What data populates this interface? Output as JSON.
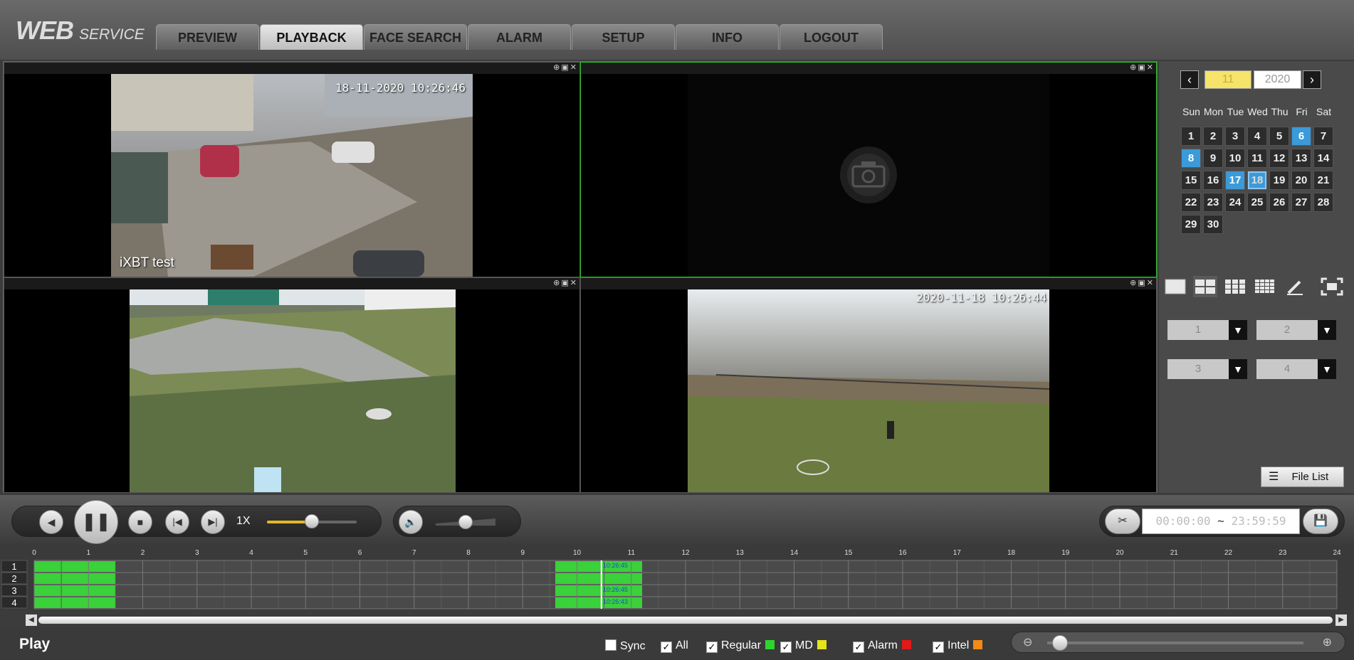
{
  "header": {
    "logo_main": "WEB",
    "logo_sub": "SERVICE",
    "tabs": [
      "PREVIEW",
      "PLAYBACK",
      "FACE SEARCH",
      "ALARM",
      "SETUP",
      "INFO",
      "LOGOUT"
    ],
    "active_tab": "PLAYBACK"
  },
  "panes": [
    {
      "channel": 1,
      "timestamp": "18-11-2020 10:26:46",
      "name": "iXBT test",
      "state": "playing"
    },
    {
      "channel": 2,
      "timestamp": "",
      "name": "",
      "state": "no-video",
      "icon": "camera-icon"
    },
    {
      "channel": 3,
      "timestamp": "",
      "name": "",
      "state": "playing"
    },
    {
      "channel": 4,
      "timestamp": "2020-11-18 10:26:44",
      "name": "",
      "state": "playing"
    }
  ],
  "pane_tool_icons": [
    "zoom-icon",
    "snapshot-icon",
    "close-icon"
  ],
  "calendar": {
    "month": "11",
    "year": "2020",
    "weekdays": [
      "Sun",
      "Mon",
      "Tue",
      "Wed",
      "Thu",
      "Fri",
      "Sat"
    ],
    "first_weekday_index": 0,
    "days": [
      "1",
      "2",
      "3",
      "4",
      "5",
      "6",
      "7",
      "8",
      "9",
      "10",
      "11",
      "12",
      "13",
      "14",
      "15",
      "16",
      "17",
      "18",
      "19",
      "20",
      "21",
      "22",
      "23",
      "24",
      "25",
      "26",
      "27",
      "28",
      "29",
      "30"
    ],
    "days_with_records": [
      6,
      8,
      17,
      18
    ],
    "selected_day": 18
  },
  "channel_selectors": [
    "1",
    "2",
    "3",
    "4"
  ],
  "file_list_label": "File List",
  "playback": {
    "speed": "1X",
    "speed_slider": 0.5,
    "volume": 0.5,
    "time_from": {
      "h": "00",
      "m": "00",
      "s": "00"
    },
    "time_to": {
      "h": "23",
      "m": "59",
      "s": "59"
    },
    "time_sep": "~"
  },
  "timeline": {
    "hours": [
      "0",
      "1",
      "2",
      "3",
      "4",
      "5",
      "6",
      "7",
      "8",
      "9",
      "10",
      "11",
      "12",
      "13",
      "14",
      "15",
      "16",
      "17",
      "18",
      "19",
      "20",
      "21",
      "22",
      "23",
      "24"
    ],
    "channels": [
      "1",
      "2",
      "3",
      "4"
    ],
    "records": [
      [
        0,
        1.5
      ],
      [
        9.6,
        11.2
      ]
    ],
    "cursor_hour": 10.45,
    "cursor_labels": [
      "10:26:45",
      "",
      "10:26:45",
      "10:26:43"
    ]
  },
  "footer": {
    "mode_label": "Play",
    "filters": [
      {
        "label": "Sync",
        "checked": false,
        "color": ""
      },
      {
        "label": "All",
        "checked": true,
        "color": ""
      },
      {
        "label": "Regular",
        "checked": true,
        "color": "#2ed52e"
      },
      {
        "label": "MD",
        "checked": true,
        "color": "#e5e51a"
      },
      {
        "label": "Alarm",
        "checked": true,
        "color": "#e01919"
      },
      {
        "label": "Intel",
        "checked": true,
        "color": "#f28a14"
      }
    ],
    "zoom_level": 0.05
  },
  "colors": {
    "record": "#3ad13a",
    "accent_blue": "#3b9ad9",
    "month_yellow": "#f5e36a"
  }
}
